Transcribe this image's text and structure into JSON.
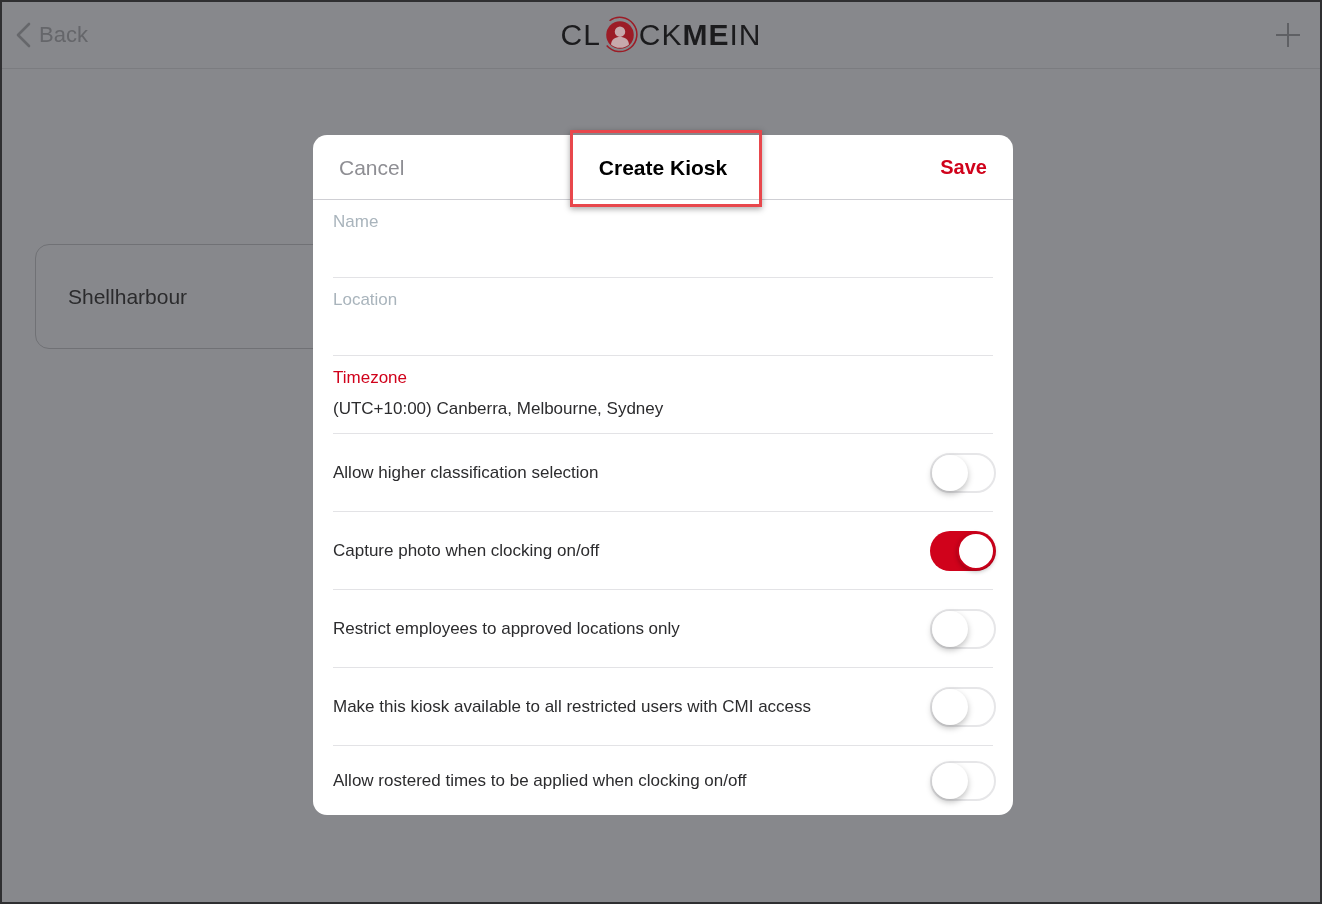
{
  "nav_bar": {
    "back": "Back",
    "logo": {
      "text_start": "CL",
      "text_end": "CK**ME**IN"
    }
  },
  "page": {
    "cards": [
      {
        "name": "Shellharbour"
      }
    ]
  },
  "dialog": {
    "cancel": "Cancel",
    "title": "Create Kiosk",
    "save": "Save",
    "fields": [
      {
        "kind": "text",
        "label": "Name"
      },
      {
        "kind": "text",
        "label": "Location"
      },
      {
        "kind": "select",
        "label": "Timezone",
        "value": "(UTC+10:00) Canberra, Melbourne, Sydney"
      }
    ],
    "options": [
      {
        "label": "Allow higher classification selection",
        "on": false
      },
      {
        "label": "Capture photo when clocking on/off",
        "on": true
      },
      {
        "label": "Restrict employees to approved locations only",
        "on": false
      },
      {
        "label": "Make this kiosk available to all restricted users with CMI access",
        "on": false
      },
      {
        "label": "Allow rostered times to be applied when clocking on/off",
        "on": false
      }
    ]
  }
}
